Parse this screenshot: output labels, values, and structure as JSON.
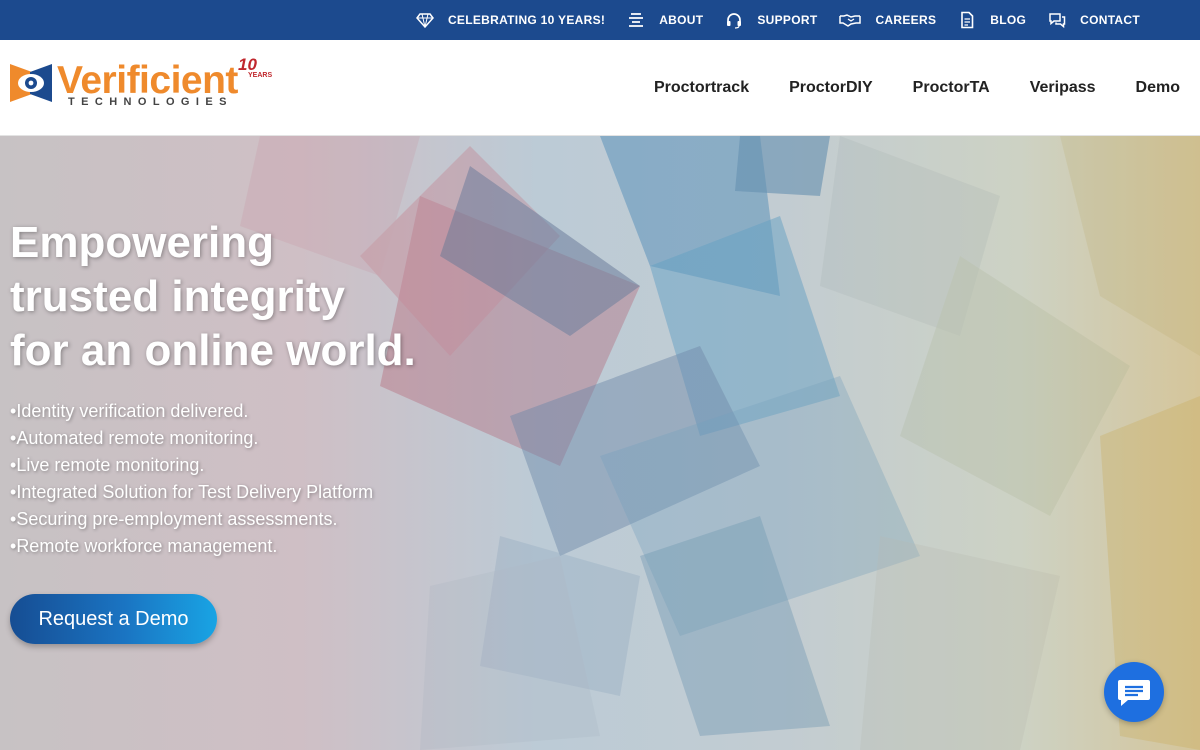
{
  "topbar": {
    "items": [
      {
        "label": "CELEBRATING 10 YEARS!",
        "icon": "diamond-icon"
      },
      {
        "label": "ABOUT",
        "icon": "menu-lines-icon"
      },
      {
        "label": "SUPPORT",
        "icon": "headset-icon"
      },
      {
        "label": "CAREERS",
        "icon": "handshake-icon"
      },
      {
        "label": "BLOG",
        "icon": "document-icon"
      },
      {
        "label": "CONTACT",
        "icon": "chat-bubbles-icon"
      }
    ]
  },
  "logo": {
    "word": "Verificient",
    "sub": "TECHNOLOGIES",
    "badge_number": "10",
    "badge_text": "YEARS",
    "colors": {
      "orange": "#ef8a2c",
      "blue": "#1c4a8e",
      "red": "#c0272d"
    }
  },
  "nav": {
    "items": [
      "Proctortrack",
      "ProctorDIY",
      "ProctorTA",
      "Veripass",
      "Demo"
    ]
  },
  "hero": {
    "title_lines": [
      "Empowering",
      "trusted integrity",
      "for an online world."
    ],
    "bullets": [
      "Identity verification delivered.",
      "Automated remote monitoring.",
      "Live remote monitoring.",
      "Integrated Solution for Test Delivery Platform",
      "Securing pre-employment assessments.",
      "Remote workforce management."
    ],
    "cta_label": "Request a Demo"
  },
  "colors": {
    "topbar_bg": "#1c4a8e",
    "cta_gradient_start": "#164d93",
    "cta_gradient_end": "#19a4e4",
    "chat_button": "#1e6fe0"
  },
  "chat_widget": {
    "icon": "chat-message-icon"
  }
}
